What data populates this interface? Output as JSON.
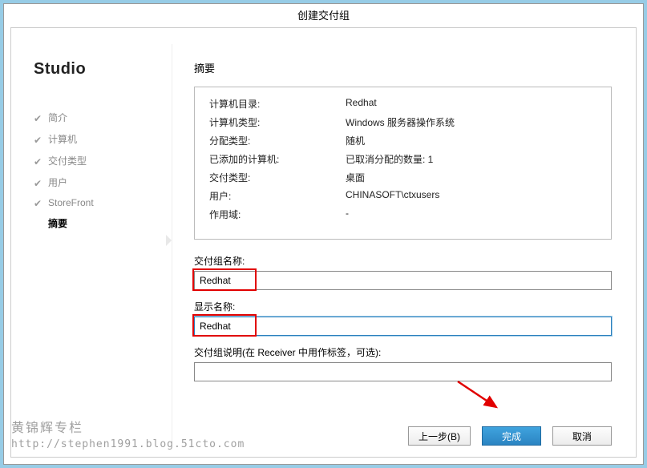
{
  "window": {
    "title": "创建交付组"
  },
  "sidebar": {
    "title": "Studio",
    "items": [
      {
        "label": "简介"
      },
      {
        "label": "计算机"
      },
      {
        "label": "交付类型"
      },
      {
        "label": "用户"
      },
      {
        "label": "StoreFront"
      },
      {
        "label": "摘要"
      }
    ]
  },
  "content": {
    "heading": "摘要",
    "summary": {
      "rows": [
        {
          "label": "计算机目录:",
          "value": "Redhat"
        },
        {
          "label": "计算机类型:",
          "value": "Windows 服务器操作系统"
        },
        {
          "label": "分配类型:",
          "value": "随机"
        },
        {
          "label": "已添加的计算机:",
          "value": "已取消分配的数量: 1"
        },
        {
          "label": "交付类型:",
          "value": "桌面"
        },
        {
          "label": "用户:",
          "value": "CHINASOFT\\ctxusers"
        },
        {
          "label": "作用域:",
          "value": "-"
        }
      ]
    },
    "fields": {
      "group_name_label": "交付组名称:",
      "group_name_value": "Redhat",
      "display_name_label": "显示名称:",
      "display_name_value": "Redhat",
      "description_label": "交付组说明(在 Receiver 中用作标签，可选):",
      "description_value": ""
    }
  },
  "buttons": {
    "back": "上一步(B)",
    "finish": "完成",
    "cancel": "取消"
  },
  "watermark": {
    "line1": "黄锦辉专栏",
    "line2": "http://stephen1991.blog.51cto.com"
  }
}
